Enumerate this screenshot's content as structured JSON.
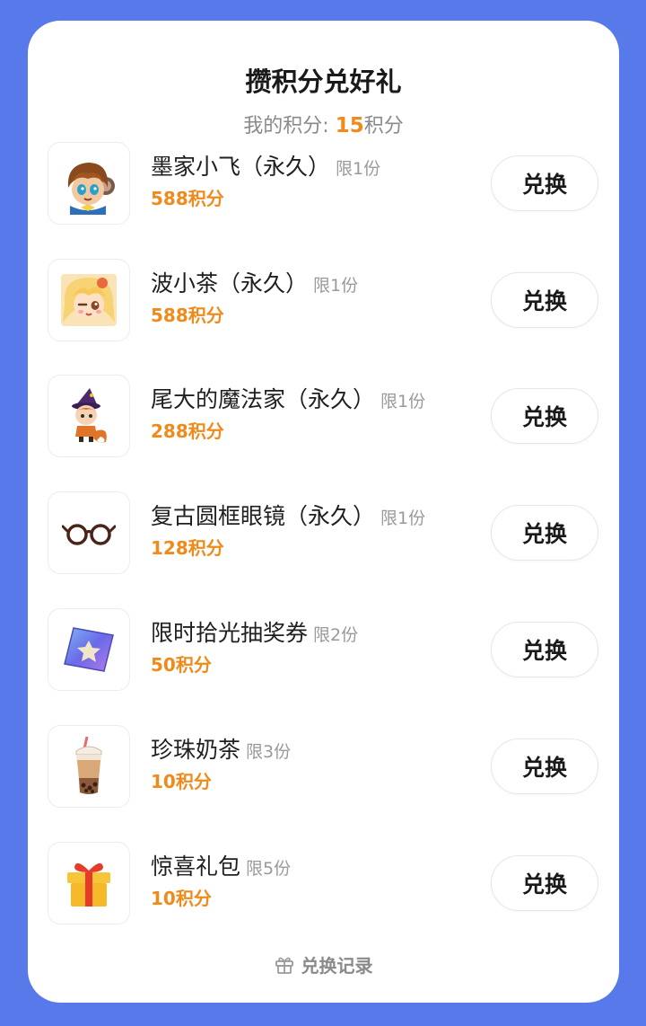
{
  "header": {
    "title": "攒积分兑好礼",
    "points_label": "我的积分: ",
    "points_value": "15",
    "points_unit": "积分"
  },
  "items": [
    {
      "name": "墨家小飞（永久）",
      "limit": "限1份",
      "cost": "588积分",
      "button": "兑换",
      "icon": "avatar-boy-icon"
    },
    {
      "name": "波小茶（永久）",
      "limit": "限1份",
      "cost": "588积分",
      "button": "兑换",
      "icon": "avatar-girl-icon"
    },
    {
      "name": "尾大的魔法家（永久）",
      "limit": "限1份",
      "cost": "288积分",
      "button": "兑换",
      "icon": "fox-wizard-icon"
    },
    {
      "name": "复古圆框眼镜（永久）",
      "limit": "限1份",
      "cost": "128积分",
      "button": "兑换",
      "icon": "glasses-icon"
    },
    {
      "name": "限时拾光抽奖券",
      "limit": "限2份",
      "cost": "50积分",
      "button": "兑换",
      "icon": "ticket-icon"
    },
    {
      "name": "珍珠奶茶",
      "limit": "限3份",
      "cost": "10积分",
      "button": "兑换",
      "icon": "bubble-tea-icon"
    },
    {
      "name": "惊喜礼包",
      "limit": "限5份",
      "cost": "10积分",
      "button": "兑换",
      "icon": "gift-box-icon"
    }
  ],
  "footer": {
    "label": "兑换记录",
    "icon": "gift-icon"
  },
  "colors": {
    "background": "#5779ea",
    "accent": "#f08a1a"
  }
}
